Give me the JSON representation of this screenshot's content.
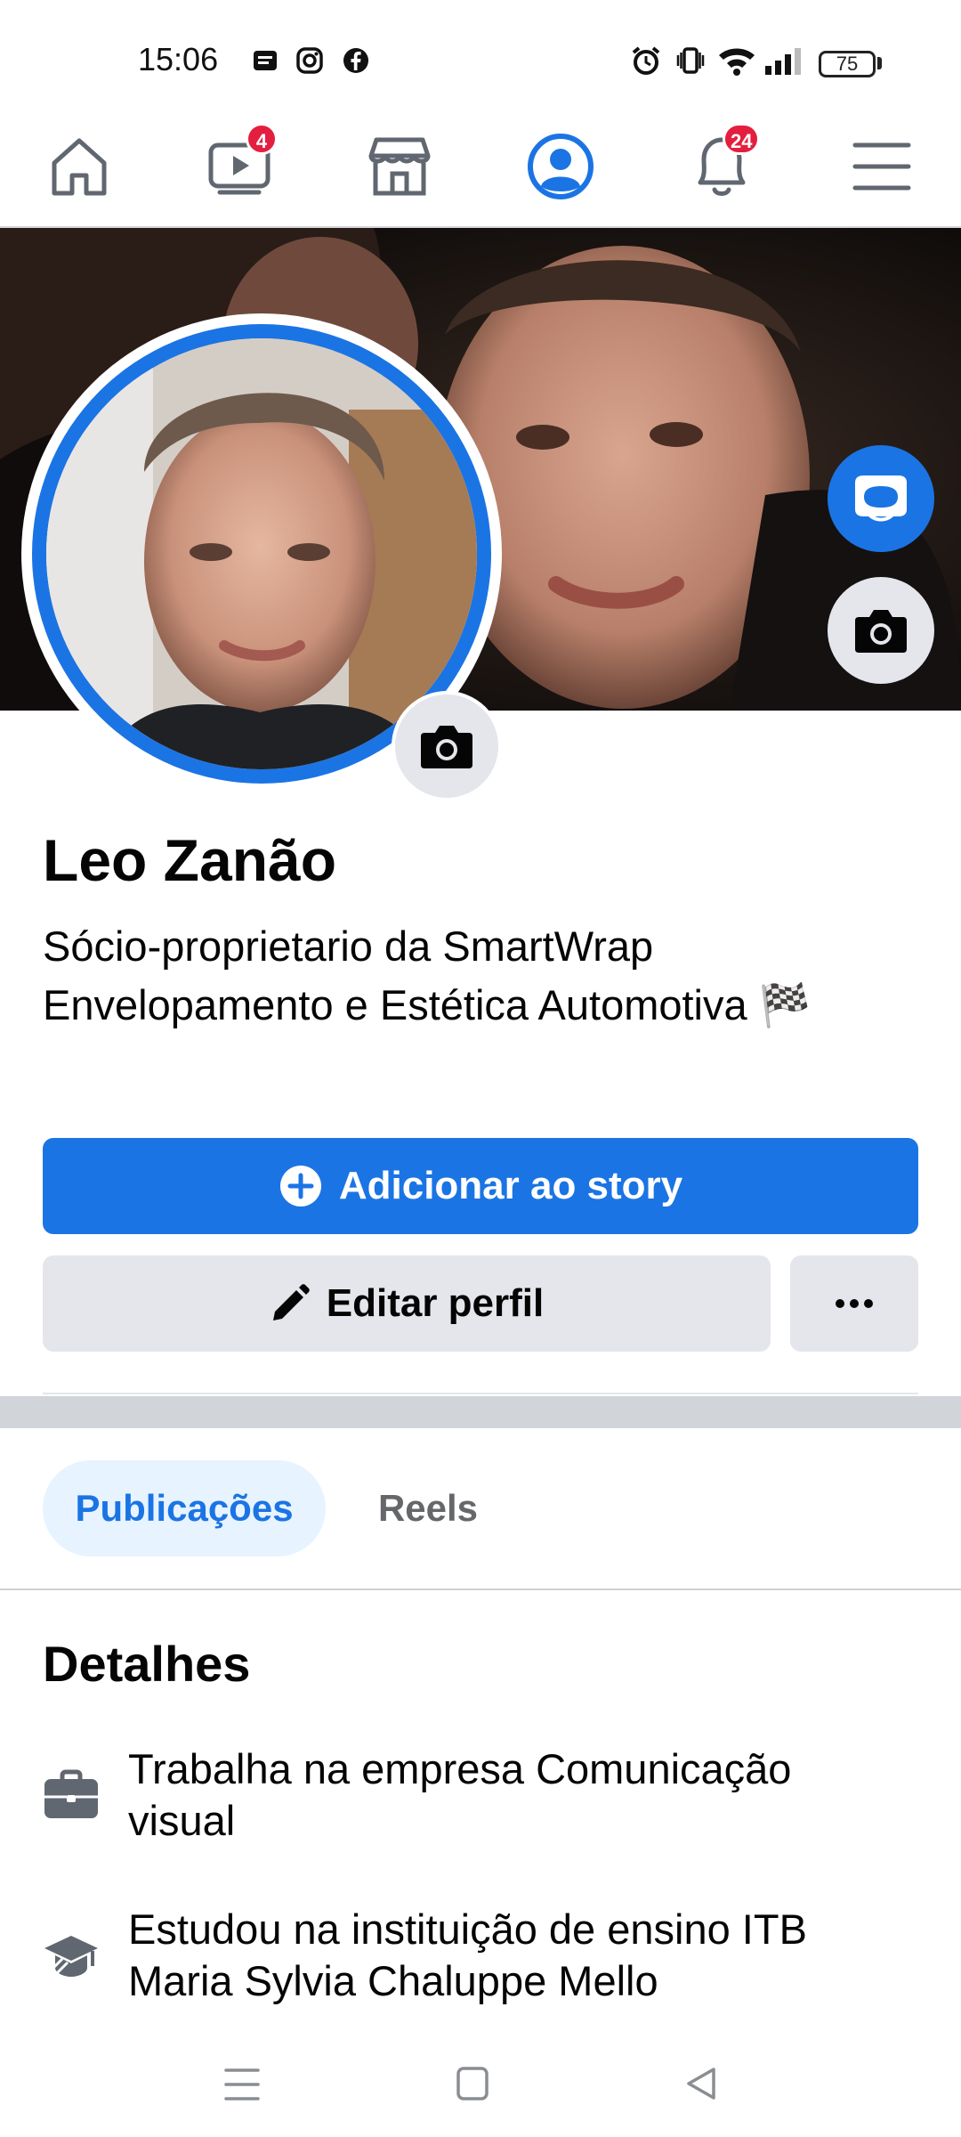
{
  "status_bar": {
    "time": "15:06",
    "battery": "75"
  },
  "nav": {
    "watch_badge": "4",
    "notifications_badge": "24"
  },
  "profile": {
    "name": "Leo Zanão",
    "bio_line1": "Sócio-proprietario da SmartWrap",
    "bio_line2": "Envelopamento e Estética Automotiva 🏁"
  },
  "buttons": {
    "add_story": "Adicionar ao story",
    "edit_profile": "Editar perfil"
  },
  "tabs": [
    {
      "label": "Publicações",
      "active": true
    },
    {
      "label": "Reels",
      "active": false
    }
  ],
  "details": {
    "title": "Detalhes",
    "items": [
      {
        "icon": "briefcase-icon",
        "line1": "Trabalha na empresa Comunicação",
        "line2": "visual"
      },
      {
        "icon": "graduation-cap-icon",
        "line1": "Estudou na instituição de ensino ITB",
        "line2": "Maria Sylvia Chaluppe Mello"
      }
    ]
  },
  "colors": {
    "accent": "#1b74e4",
    "badge": "#e41e3f",
    "button_gray": "#e4e6eb"
  }
}
